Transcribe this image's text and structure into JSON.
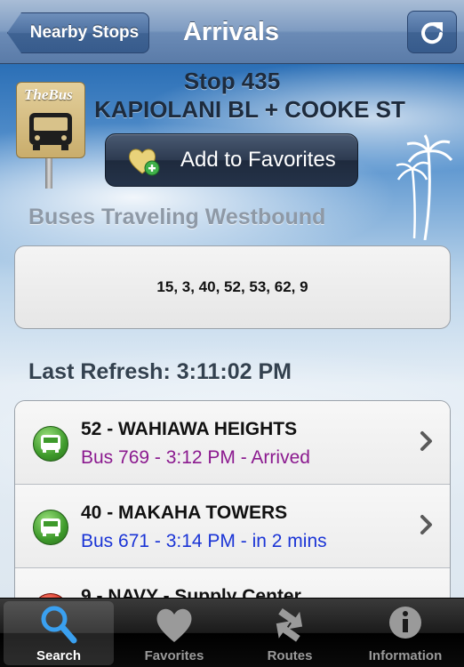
{
  "navbar": {
    "back_label": "Nearby Stops",
    "title": "Arrivals",
    "refresh_icon": "refresh-icon"
  },
  "stop": {
    "number": "Stop 435",
    "name": "KAPIOLANI BL + COOKE ST",
    "logo_text": "TheBus"
  },
  "favorites_button": {
    "label": "Add to Favorites",
    "icon": "heart-add-icon"
  },
  "direction": {
    "title": "Buses Traveling Westbound"
  },
  "routes": {
    "list": "15, 3, 40, 52, 53, 62, 9"
  },
  "refresh": {
    "text": "Last Refresh: 3:11:02 PM"
  },
  "arrivals": [
    {
      "route": "52 - WAHIAWA HEIGHTS",
      "detail": "Bus 769 - 3:12 PM - Arrived",
      "detail_color": "#8b1a8f",
      "icon": "bus-icon",
      "status": "green"
    },
    {
      "route": "40 - MAKAHA TOWERS",
      "detail": "Bus 671 - 3:14 PM - in 2 mins",
      "detail_color": "#1a34d6",
      "icon": "bus-icon",
      "status": "green"
    },
    {
      "route": "9 - NAVY - Supply Center",
      "detail": "",
      "detail_color": "#1a34d6",
      "icon": "bus-icon",
      "status": "red"
    }
  ],
  "tabbar": {
    "tabs": [
      {
        "label": "Search",
        "icon": "search-icon",
        "selected": true
      },
      {
        "label": "Favorites",
        "icon": "heart-icon",
        "selected": false
      },
      {
        "label": "Routes",
        "icon": "routes-icon",
        "selected": false
      },
      {
        "label": "Information",
        "icon": "info-icon",
        "selected": false
      }
    ]
  }
}
